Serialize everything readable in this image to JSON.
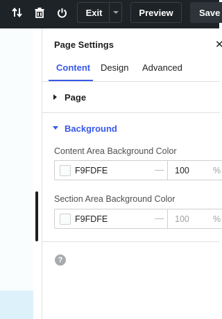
{
  "toolbar": {
    "icons": [
      "sort-arrows-icon",
      "trash-icon",
      "power-icon"
    ],
    "exit_label": "Exit",
    "preview_label": "Preview",
    "save_label": "Save"
  },
  "panel": {
    "title": "Page Settings",
    "tabs": [
      {
        "label": "Content",
        "active": true
      },
      {
        "label": "Design",
        "active": false
      },
      {
        "label": "Advanced",
        "active": false
      }
    ],
    "sections": {
      "page": {
        "label": "Page",
        "expanded": false
      },
      "background": {
        "label": "Background",
        "expanded": true,
        "fields": [
          {
            "label": "Content Area Background Color",
            "hex": "F9FDFE",
            "separator": "—",
            "opacity": "100",
            "opacity_placeholder": false,
            "unit": "%"
          },
          {
            "label": "Section Area Background Color",
            "hex": "F9FDFE",
            "separator": "—",
            "opacity": "100",
            "opacity_placeholder": true,
            "unit": "%"
          }
        ]
      }
    }
  },
  "colors": {
    "accent": "#3858e9",
    "toolbar_bg": "#1e2327",
    "canvas_bg": "#f9fdfe",
    "swatch": "#F9FDFE"
  }
}
